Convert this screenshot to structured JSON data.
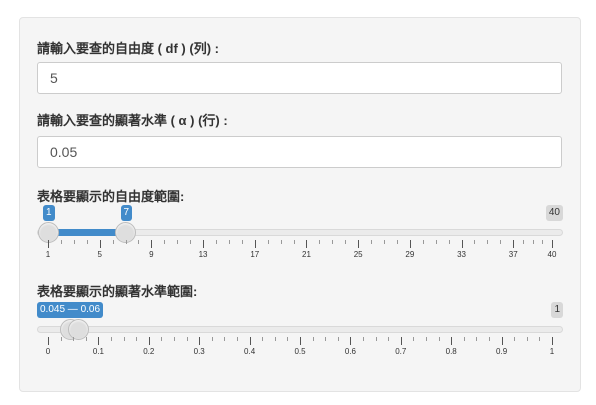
{
  "df_label": "請輸入要查的自由度 ( df ) (列) :",
  "df_value": "5",
  "alpha_label": "請輸入要查的顯著水準 ( α ) (行) :",
  "alpha_value": "0.05",
  "df_range": {
    "label": "表格要顯示的自由度範圍:",
    "min": 1,
    "max": 40,
    "from": 1,
    "to": 7,
    "min_label": "1",
    "max_label": "40",
    "from_label": "1",
    "to_label": "7",
    "major_ticks": [
      "1",
      "5",
      "9",
      "13",
      "17",
      "21",
      "25",
      "29",
      "33",
      "37",
      "40"
    ],
    "accent_color": "#428bca"
  },
  "alpha_range": {
    "label": "表格要顯示的顯著水準範圍:",
    "min": 0,
    "max": 1,
    "from": 0.045,
    "to": 0.06,
    "max_label": "1",
    "value_label": "0.045 — 0.06",
    "major_ticks": [
      "0",
      "0.1",
      "0.2",
      "0.3",
      "0.4",
      "0.5",
      "0.6",
      "0.7",
      "0.8",
      "0.9",
      "1"
    ],
    "accent_color": "#428bca"
  }
}
